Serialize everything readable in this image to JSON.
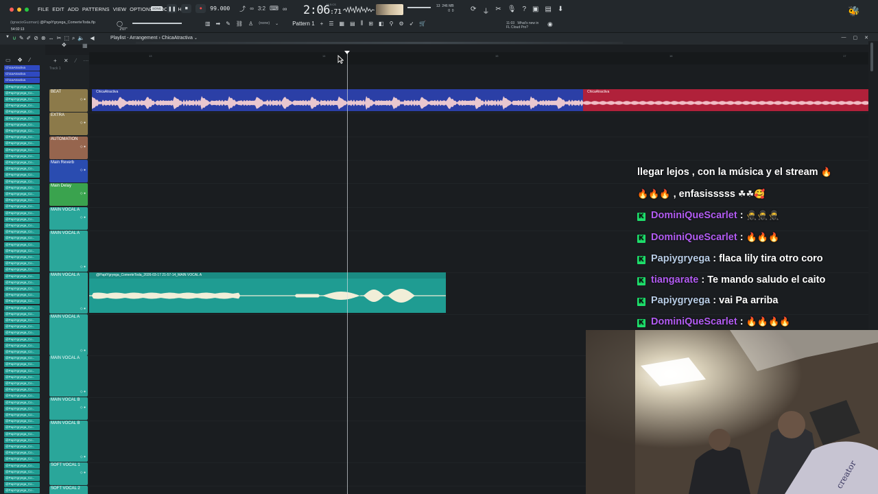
{
  "menu": [
    "FILE",
    "EDIT",
    "ADD",
    "PATTERNS",
    "VIEW",
    "OPTIONS",
    "TOOLS",
    "HELP"
  ],
  "project": {
    "user": "(ignacioGuzman)",
    "file": "@PapiYgryega_ComerteToda.flp",
    "time_elapsed": "54:02:13",
    "time2": "2'07\""
  },
  "transport": {
    "song_tag": "SONG",
    "tempo": "99.000",
    "time_main": "2:06",
    "time_sub": "71",
    "time_unit": "M:S:CS"
  },
  "cpu": {
    "line1": "13",
    "line2": "0",
    "ram": "246 MB",
    "ram2": "0"
  },
  "pattern": {
    "name": "Pattern 1",
    "none_label": "(none)"
  },
  "news": {
    "time": "11:03",
    "line1": "What's new in",
    "line2": "FL Cloud Pro?"
  },
  "playlist": {
    "title": "Playlist - Arrangement",
    "sep": "›",
    "clip": "ChicaAtractiva",
    "track1_label": "Track 1"
  },
  "ruler_ticks": [
    "13",
    "14",
    "15",
    "16",
    "17"
  ],
  "left_clips": {
    "beat": [
      "ChicaAtractiva",
      "ChicaAtractiva",
      "ChicaAtractiva"
    ],
    "vocal_label": "@PapiYgryega_Co..."
  },
  "tracks": [
    {
      "name": "BEAT",
      "color": "#8c7a4a"
    },
    {
      "name": "EXTRA",
      "color": "#8c7a4a"
    },
    {
      "name": "AUTOMATION",
      "color": "#96654e"
    },
    {
      "name": "Main Reverb",
      "color": "#2a4cb0"
    },
    {
      "name": "Main Delay",
      "color": "#3aa34e"
    },
    {
      "name": "MAIN VOCAL A",
      "color": "#2aa69a"
    },
    {
      "name": "MAIN VOCAL A",
      "color": "#2aa69a"
    },
    {
      "name": "MAIN VOCAL A",
      "color": "#2aa69a"
    },
    {
      "name": "MAIN VOCAL A",
      "color": "#2aa69a"
    },
    {
      "name": "MAIN VOCAL A",
      "color": "#2aa69a"
    },
    {
      "name": "MAIN VOCAL B",
      "color": "#2aa69a"
    },
    {
      "name": "MAIN VOCAL B",
      "color": "#2aa69a"
    },
    {
      "name": "SOFT VOCAL 1",
      "color": "#2aa69a"
    },
    {
      "name": "SOFT VOCAL 2",
      "color": "#2aa69a"
    }
  ],
  "clips": {
    "beat_blue": "ChicaAtractiva",
    "beat_red": "ChicaAtractiva",
    "vocal": "@PapiYgryega_ComerteToda_2026-03-17 21-57-14_MAIN VOCAL A"
  },
  "chat": [
    {
      "type": "text",
      "text": "llegar lejos , con la música y el stream",
      "emoji": "🔥"
    },
    {
      "type": "text",
      "text": ", enfasisssss",
      "lead_emoji": "🔥🔥🔥",
      "emoji": "☘☘🥰"
    },
    {
      "type": "msg",
      "user": "DominiQueScarlet",
      "user_color": "#b25cf2",
      "message": "",
      "emoji": "🥷🥷🥷"
    },
    {
      "type": "msg",
      "user": "DominiQueScarlet",
      "user_color": "#b25cf2",
      "message": "",
      "emoji": "🔥🔥🔥"
    },
    {
      "type": "msg",
      "user": "Papiygryega",
      "user_color": "#b8cde6",
      "message": "flaca lily tira otro coro",
      "emoji": ""
    },
    {
      "type": "msg",
      "user": "tiangarate",
      "user_color": "#b25cf2",
      "message": "Te mando saludo el caito",
      "emoji": ""
    },
    {
      "type": "msg",
      "user": "Papiygryega",
      "user_color": "#b8cde6",
      "message": "vai Pa arriba",
      "emoji": ""
    },
    {
      "type": "msg",
      "user": "DominiQueScarlet",
      "user_color": "#b25cf2",
      "message": "",
      "emoji": "🔥🔥🔥🔥"
    }
  ],
  "icons": {
    "kick": "K",
    "colon": ":"
  },
  "colors": {
    "beat_clip": "#2b3fa6",
    "beat_red": "#b0213a",
    "vocal_clip": "#1f9c92",
    "accent_green": "#1ee06c"
  }
}
